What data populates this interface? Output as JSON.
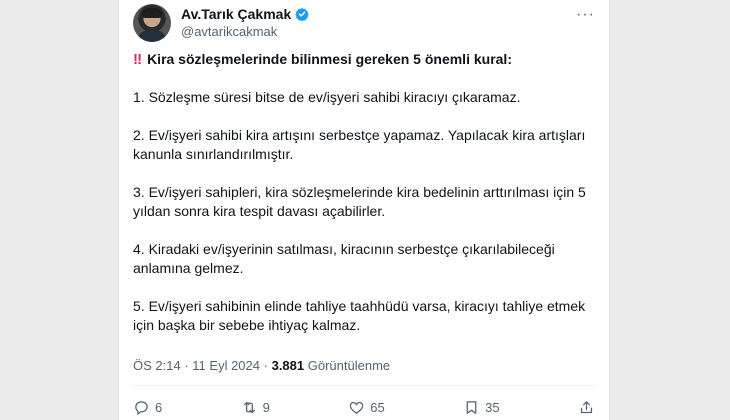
{
  "author": {
    "display_name": "Av.Tarık Çakmak",
    "handle": "@avtarikcakmak"
  },
  "tweet": {
    "heading": "Kira sözleşmelerinde bilinmesi gereken 5 önemli kural:",
    "heading_emoji": "‼",
    "rules": [
      [
        "1. Sözleşme süresi bitse de ev/işyeri sahibi kiracıyı çıkaramaz."
      ],
      [
        "2. Ev/işyeri sahibi kira artışını serbestçe yapamaz. Yapılacak kira artışları",
        "kanunla sınırlandırılmıştır."
      ],
      [
        "3. Ev/işyeri sahipleri, kira sözleşmelerinde kira bedelinin arttırılması için 5",
        "yıldan sonra kira tespit davası açabilirler."
      ],
      [
        "4. Kiradaki ev/işyerinin satılması, kiracının serbestçe çıkarılabileceği",
        "anlamına gelmez."
      ],
      [
        "5. Ev/işyeri sahibinin elinde tahliye taahhüdü varsa, kiracıyı tahliye etmek",
        "için başka bir sebebe ihtiyaç kalmaz."
      ]
    ]
  },
  "meta": {
    "time": "ÖS 2:14",
    "separator": "·",
    "date": "11 Eyl 2024",
    "views_count": "3.881",
    "views_label": "Görüntülenme"
  },
  "actions": {
    "reply_count": "6",
    "retweet_count": "9",
    "like_count": "65",
    "bookmark_count": "35"
  },
  "colors": {
    "verified_blue": "#1d9bf0",
    "emoji_red": "#e0245e",
    "secondary_text": "#536471"
  }
}
